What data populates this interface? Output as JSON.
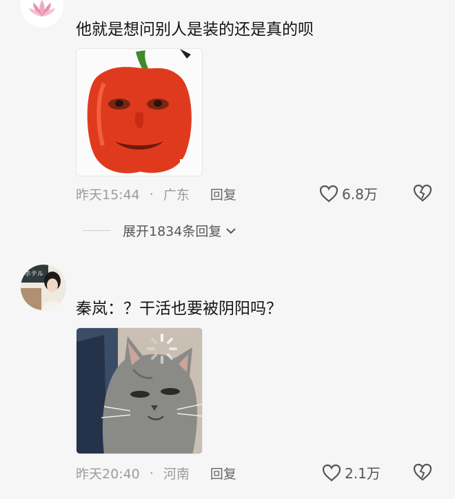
{
  "comments": [
    {
      "avatar_icon": "lotus-icon",
      "text": "他就是想问别人是装的还是真的呗",
      "sticker_desc": "red-pepper-face-sticker",
      "time": "昨天15:44",
      "separator": "·",
      "location": "广东",
      "reply_label": "回复",
      "likes": "6.8万",
      "expand_text": "展开1834条回复"
    },
    {
      "avatar_icon": "user-photo-avatar",
      "text": "秦岚：？干活也要被阴阳吗？",
      "sticker_desc": "tired-cat-loading-sticker",
      "time": "昨天20:40",
      "separator": "·",
      "location": "河南",
      "reply_label": "回复",
      "likes": "2.1万"
    }
  ],
  "colors": {
    "background": "#f6f6f6",
    "meta_text": "#9b9b9b",
    "pepper_red": "#e03a1e",
    "cat_gray": "#8a8a86"
  }
}
